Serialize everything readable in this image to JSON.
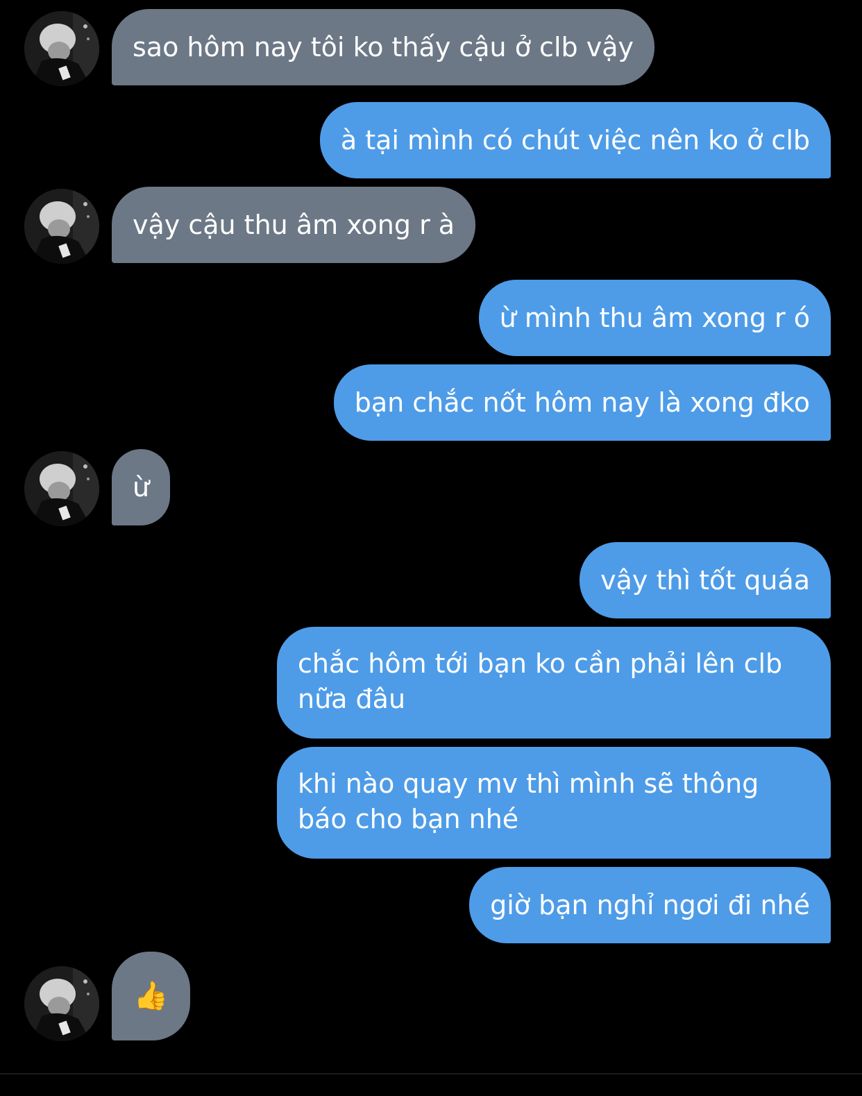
{
  "conversation": {
    "messages": [
      {
        "direction": "incoming",
        "text": "sao hôm nay tôi ko thấy cậu ở clb vậy"
      },
      {
        "direction": "outgoing",
        "text": "à tại mình có chút việc nên ko ở clb"
      },
      {
        "direction": "incoming",
        "text": "vậy cậu thu âm xong r à"
      },
      {
        "direction": "outgoing",
        "text": "ừ mình thu âm xong r ó"
      },
      {
        "direction": "outgoing",
        "text": "bạn chắc nốt hôm nay là xong đko"
      },
      {
        "direction": "incoming",
        "text": "ừ"
      },
      {
        "direction": "outgoing",
        "text": "vậy thì tốt quáa"
      },
      {
        "direction": "outgoing",
        "text": "chắc hôm tới bạn ko cần phải lên clb\nnữa đâu"
      },
      {
        "direction": "outgoing",
        "text": "khi nào quay mv thì mình sẽ thông\nbáo cho bạn nhé"
      },
      {
        "direction": "outgoing",
        "text": "giờ bạn nghỉ ngơi đi nhé"
      },
      {
        "direction": "incoming",
        "icon": "thumbs-up-icon",
        "text": "👍"
      }
    ]
  },
  "colors": {
    "background": "#000000",
    "incoming_bubble": "#6c7886",
    "outgoing_bubble": "#4e9ce8",
    "text": "#ffffff"
  }
}
